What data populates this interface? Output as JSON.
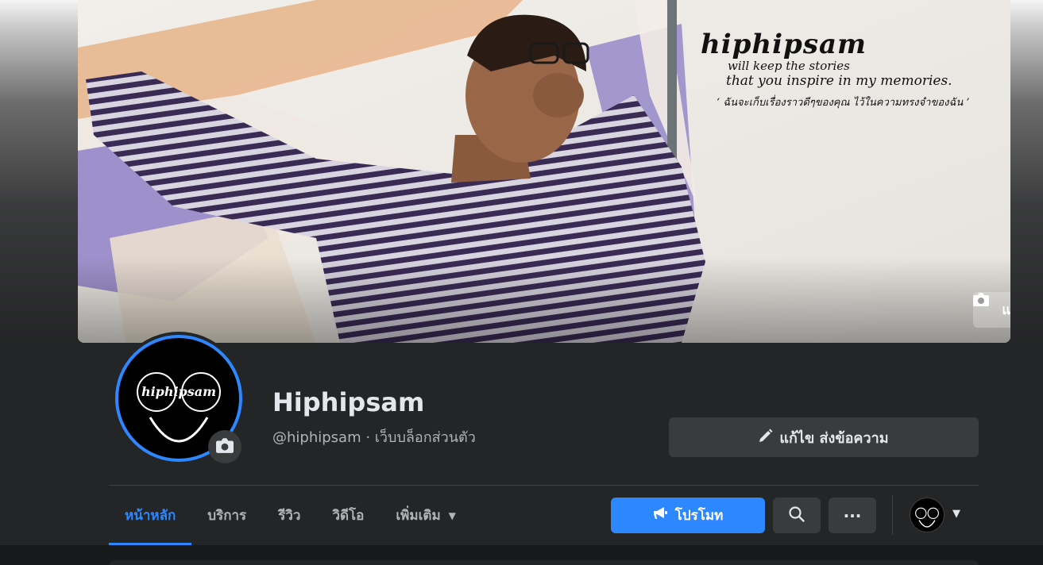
{
  "cover": {
    "title": "hiphipsam",
    "line1": "will keep the stories",
    "line2": "that you inspire in my memories.",
    "line3": "‘ ฉันจะเก็บเรื่องราวดีๆของคุณ ไว้ในความทรงจำของฉัน ’",
    "edit_label": "แก้ไข"
  },
  "avatar": {
    "text": "hiphipsam"
  },
  "page": {
    "name": "Hiphipsam",
    "subtitle": "@hiphipsam · เว็บบล็อกส่วนตัว"
  },
  "actions": {
    "edit_message_label": "แก้ไข ส่งข้อความ",
    "promote_label": "โปรโมท",
    "more_label": "···"
  },
  "tabs": [
    {
      "label": "หน้าหลัก"
    },
    {
      "label": "บริการ"
    },
    {
      "label": "รีวิว"
    },
    {
      "label": "วิดีโอ"
    },
    {
      "label": "เพิ่มเติม"
    }
  ],
  "icons": {
    "camera": "camera-icon",
    "pencil": "pencil-icon",
    "megaphone": "megaphone-icon",
    "search": "search-icon",
    "more": "more-icon",
    "caret": "caret-down-icon"
  },
  "colors": {
    "accent": "#2d88ff",
    "background": "#242526",
    "button_bg": "#3a3b3c",
    "text_primary": "#e4e6eb",
    "text_secondary": "#b0b3b8"
  }
}
